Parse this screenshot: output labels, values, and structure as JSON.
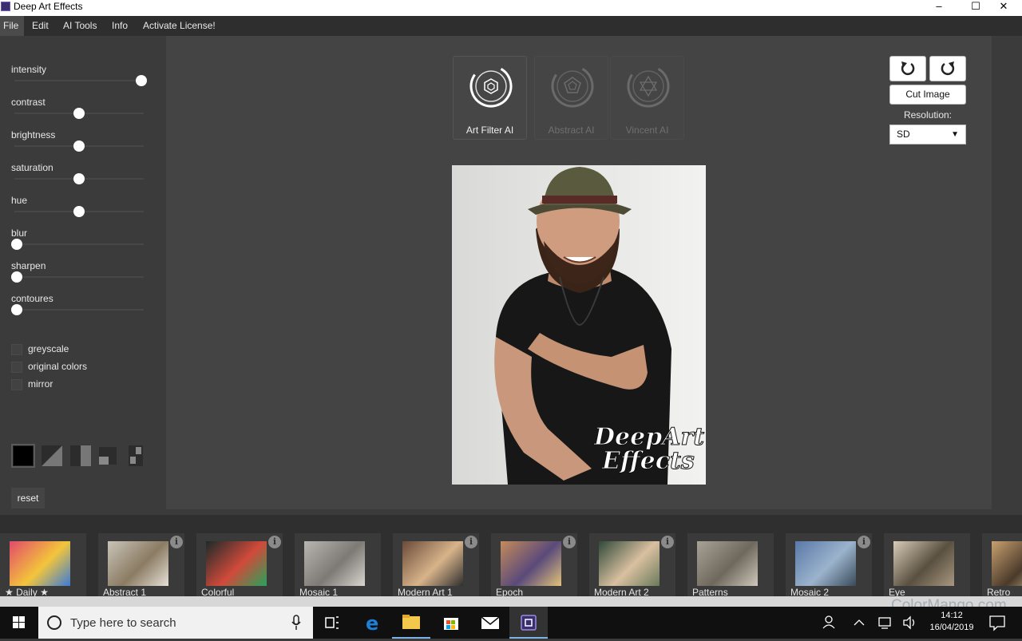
{
  "window": {
    "title": "Deep Art Effects",
    "minimize": "–",
    "maximize": "☐",
    "close": "✕"
  },
  "menu": [
    "File",
    "Edit",
    "AI Tools",
    "Info",
    "Activate License!"
  ],
  "sliders": [
    {
      "label": "intensity",
      "value": 1.0
    },
    {
      "label": "contrast",
      "value": 0.5
    },
    {
      "label": "brightness",
      "value": 0.5
    },
    {
      "label": "saturation",
      "value": 0.5
    },
    {
      "label": "hue",
      "value": 0.5
    },
    {
      "label": "blur",
      "value": 0.0
    },
    {
      "label": "sharpen",
      "value": 0.0
    },
    {
      "label": "contoures",
      "value": 0.0
    }
  ],
  "checkboxes": [
    {
      "label": "greyscale",
      "checked": false
    },
    {
      "label": "original colors",
      "checked": false
    },
    {
      "label": "mirror",
      "checked": false
    }
  ],
  "reset_label": "reset",
  "ai_modes": [
    {
      "label": "Art Filter AI",
      "enabled": true
    },
    {
      "label": "Abstract AI",
      "enabled": false
    },
    {
      "label": "Vincent AI",
      "enabled": false
    }
  ],
  "tools": {
    "undo_icon": "undo-icon",
    "redo_icon": "redo-icon",
    "cut_image": "Cut Image",
    "resolution_label": "Resolution:",
    "resolution_value": "SD"
  },
  "photo_logo": {
    "line1": "DeepArt",
    "line2": "Effects"
  },
  "gallery": [
    {
      "label": "★ Daily ★",
      "info": false,
      "colors": [
        "#e24a6a",
        "#f3c53b",
        "#3b7bd6"
      ]
    },
    {
      "label": "Abstract 1",
      "info": true,
      "colors": [
        "#c9c4b8",
        "#8b7b63",
        "#e6e1d6"
      ]
    },
    {
      "label": "Colorful",
      "info": true,
      "colors": [
        "#1b2a2a",
        "#d14a3a",
        "#27a35a"
      ]
    },
    {
      "label": "Mosaic 1",
      "info": false,
      "colors": [
        "#b9b6b2",
        "#7d7a75",
        "#d9d6d0"
      ]
    },
    {
      "label": "Modern Art 1",
      "info": true,
      "colors": [
        "#6a4a3a",
        "#d8b48a",
        "#2f2f2f"
      ]
    },
    {
      "label": "Epoch",
      "info": true,
      "colors": [
        "#c48a5a",
        "#5a4a7a",
        "#e2c27a"
      ]
    },
    {
      "label": "Modern Art 2",
      "info": true,
      "colors": [
        "#2f4a3a",
        "#d9c0a0",
        "#6a7a5a"
      ]
    },
    {
      "label": "Patterns",
      "info": false,
      "colors": [
        "#a9a296",
        "#6f685c",
        "#cfc8bb"
      ]
    },
    {
      "label": "Mosaic 2",
      "info": true,
      "colors": [
        "#5a78a8",
        "#9bb3cc",
        "#3a4a5a"
      ]
    },
    {
      "label": "Eye",
      "info": false,
      "colors": [
        "#d8ccb8",
        "#5a5040",
        "#a89880"
      ]
    },
    {
      "label": "Retro",
      "info": false,
      "colors": [
        "#c8a070",
        "#4a3a2a",
        "#e8d0a0"
      ]
    }
  ],
  "taskbar": {
    "search_placeholder": "Type here to search",
    "time": "14:12",
    "date": "16/04/2019"
  },
  "watermark": "ColorMango.com",
  "colors": {
    "accent": "#6c5ab6",
    "canvas": "#444444",
    "panel": "#3b3b3b"
  }
}
